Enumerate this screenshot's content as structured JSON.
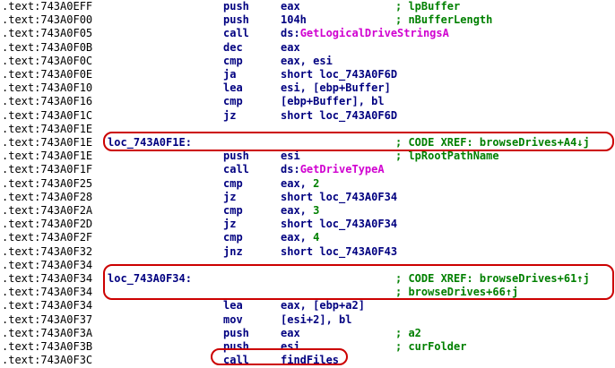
{
  "colors": {
    "addr": "#000000",
    "code": "#000080",
    "comment": "#008000",
    "import": "#d000d0",
    "highlight": "#cc0000"
  },
  "rows": [
    {
      "addr": ".text:743A0EFF",
      "mn": "push",
      "op": "eax",
      "cm": "; lpBuffer"
    },
    {
      "addr": ".text:743A0F00",
      "mn": "push",
      "op": "104h",
      "cm": "; nBufferLength"
    },
    {
      "addr": ".text:743A0F05",
      "mn": "call",
      "op_pre": "ds:",
      "op_imp": "GetLogicalDriveStringsA"
    },
    {
      "addr": ".text:743A0F0B",
      "mn": "dec",
      "op": "eax"
    },
    {
      "addr": ".text:743A0F0C",
      "mn": "cmp",
      "op": "eax, esi"
    },
    {
      "addr": ".text:743A0F0E",
      "mn": "ja",
      "op": "short loc_743A0F6D"
    },
    {
      "addr": ".text:743A0F10",
      "mn": "lea",
      "op": "esi, [ebp+Buffer]"
    },
    {
      "addr": ".text:743A0F16",
      "mn": "cmp",
      "op": "[ebp+Buffer], bl"
    },
    {
      "addr": ".text:743A0F1C",
      "mn": "jz",
      "op": "short loc_743A0F6D"
    },
    {
      "addr": ".text:743A0F1E"
    },
    {
      "addr": ".text:743A0F1E",
      "label": "loc_743A0F1E:",
      "cm": "; CODE XREF: browseDrives+A4↓j"
    },
    {
      "addr": ".text:743A0F1E",
      "mn": "push",
      "op": "esi",
      "cm": "; lpRootPathName"
    },
    {
      "addr": ".text:743A0F1F",
      "mn": "call",
      "op_pre": "ds:",
      "op_imp": "GetDriveTypeA"
    },
    {
      "addr": ".text:743A0F25",
      "mn": "cmp",
      "op": "eax, ",
      "op_num": "2"
    },
    {
      "addr": ".text:743A0F28",
      "mn": "jz",
      "op": "short loc_743A0F34"
    },
    {
      "addr": ".text:743A0F2A",
      "mn": "cmp",
      "op": "eax, ",
      "op_num": "3"
    },
    {
      "addr": ".text:743A0F2D",
      "mn": "jz",
      "op": "short loc_743A0F34"
    },
    {
      "addr": ".text:743A0F2F",
      "mn": "cmp",
      "op": "eax, ",
      "op_num": "4"
    },
    {
      "addr": ".text:743A0F32",
      "mn": "jnz",
      "op": "short loc_743A0F43"
    },
    {
      "addr": ".text:743A0F34"
    },
    {
      "addr": ".text:743A0F34",
      "label": "loc_743A0F34:",
      "cm": "; CODE XREF: browseDrives+61↑j"
    },
    {
      "addr": ".text:743A0F34",
      "cm": "; browseDrives+66↑j"
    },
    {
      "addr": ".text:743A0F34",
      "mn": "lea",
      "op": "eax, [ebp+a2]"
    },
    {
      "addr": ".text:743A0F37",
      "mn": "mov",
      "op": "[esi+2], bl"
    },
    {
      "addr": ".text:743A0F3A",
      "mn": "push",
      "op": "eax",
      "cm": "; a2"
    },
    {
      "addr": ".text:743A0F3B",
      "mn": "push",
      "op": "esi",
      "cm": "; curFolder"
    },
    {
      "addr": ".text:743A0F3C",
      "mn": "call",
      "op": "findFiles"
    }
  ]
}
